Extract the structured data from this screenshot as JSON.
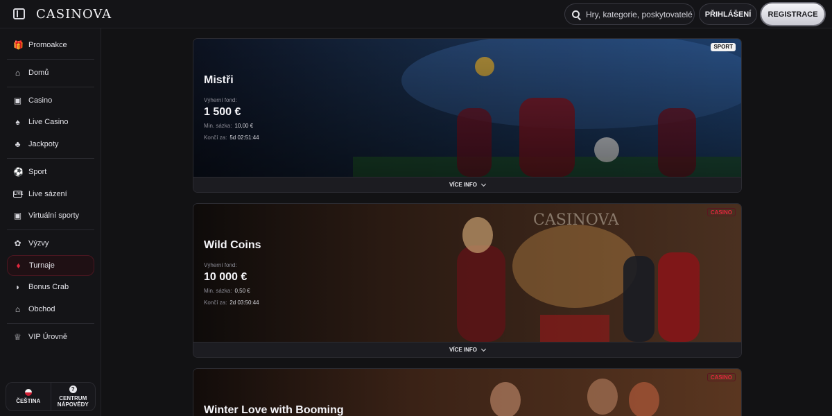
{
  "header": {
    "logo": "CASINOVA",
    "search_placeholder": "Hry, kategorie, poskytovatelé",
    "login_label": "PŘIHLÁŠENÍ",
    "register_label": "REGISTRACE"
  },
  "sidebar": {
    "items": [
      {
        "label": "Promoakce",
        "icon": "gift-icon"
      },
      {
        "label": "Domů",
        "icon": "home-icon"
      },
      {
        "label": "Casino",
        "icon": "slot-machine-icon"
      },
      {
        "label": "Live Casino",
        "icon": "live-dealer-icon"
      },
      {
        "label": "Jackpoty",
        "icon": "clover-icon"
      },
      {
        "label": "Sport",
        "icon": "football-icon"
      },
      {
        "label": "Live sázení",
        "icon": "live-badge-icon"
      },
      {
        "label": "Virtuální sporty",
        "icon": "monitor-icon"
      },
      {
        "label": "Výzvy",
        "icon": "medal-icon"
      },
      {
        "label": "Turnaje",
        "icon": "diamond-icon",
        "active": true
      },
      {
        "label": "Bonus Crab",
        "icon": "crab-claw-icon"
      },
      {
        "label": "Obchod",
        "icon": "shop-icon"
      },
      {
        "label": "VIP Úrovně",
        "icon": "crown-icon"
      }
    ],
    "language_label": "ČEŠTINA",
    "help_label_1": "CENTRUM",
    "help_label_2": "NÁPOVĚDY",
    "help_glyph": "?"
  },
  "tournaments": [
    {
      "title": "Mistři",
      "tag": "SPORT",
      "pool_label": "Výherní fond:",
      "pool": "1 500 €",
      "min_bet_label": "Min. sázka:",
      "min_bet": "10,00 €",
      "ends_label": "Končí za:",
      "ends": "5d 02:51:44",
      "more_label": "VÍCE INFO"
    },
    {
      "title": "Wild Coins",
      "tag": "CASINO",
      "pool_label": "Výherní fond:",
      "pool": "10 000 €",
      "min_bet_label": "Min. sázka:",
      "min_bet": "0,50 €",
      "ends_label": "Končí za:",
      "ends": "2d 03:50:44",
      "more_label": "VÍCE INFO"
    },
    {
      "title": "Winter Love with Booming",
      "tag": "CASINO"
    }
  ],
  "colors": {
    "accent_red": "#e0263d",
    "background": "#121214"
  }
}
